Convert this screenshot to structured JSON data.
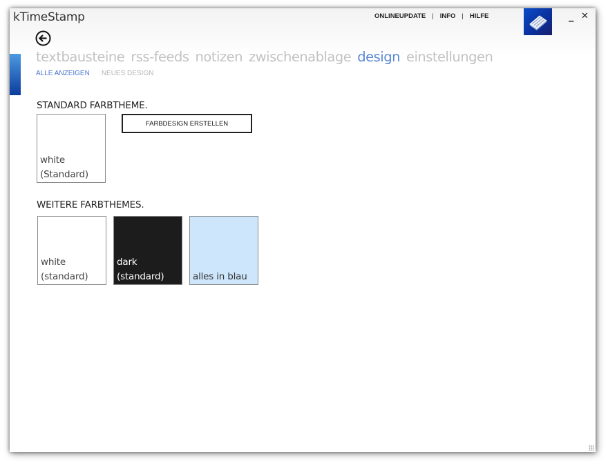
{
  "window": {
    "title": "kTimeStamp"
  },
  "top_links": [
    "ONLINEUPDATE",
    "INFO",
    "HILFE"
  ],
  "top_link_separator": "|",
  "window_controls": {
    "minimize": "_",
    "close": "✕"
  },
  "nav": {
    "tabs": [
      "textbausteine",
      "rss-feeds",
      "notizen",
      "zwischenablage",
      "design",
      "einstellungen"
    ],
    "active_tab": "design"
  },
  "subnav": {
    "items": [
      "ALLE ANZEIGEN",
      "NEUES DESIGN"
    ],
    "active": "ALLE ANZEIGEN"
  },
  "standard_section": {
    "title": "STANDARD FARBTHEME.",
    "tile": {
      "label": "white\n(Standard)",
      "background": "#ffffff",
      "text_color": "#444444"
    },
    "create_button": "FARBDESIGN ERSTELLEN"
  },
  "more_section": {
    "title": "WEITERE FARBTHEMES.",
    "tiles": [
      {
        "label": "white\n(standard)",
        "background": "#ffffff",
        "text_color": "#444444"
      },
      {
        "label": "dark\n(standard)",
        "background": "#1c1c1c",
        "text_color": "#ffffff"
      },
      {
        "label": "alles in blau",
        "background": "#cde6fc",
        "text_color": "#333333"
      }
    ]
  },
  "colors": {
    "accent": "#5a86d8",
    "inactive_nav": "#c2c2c2",
    "app_icon": "#0a3cb4"
  },
  "icons": {
    "back": "arrow-left-circle-icon",
    "app": "keyboard-app-icon"
  }
}
